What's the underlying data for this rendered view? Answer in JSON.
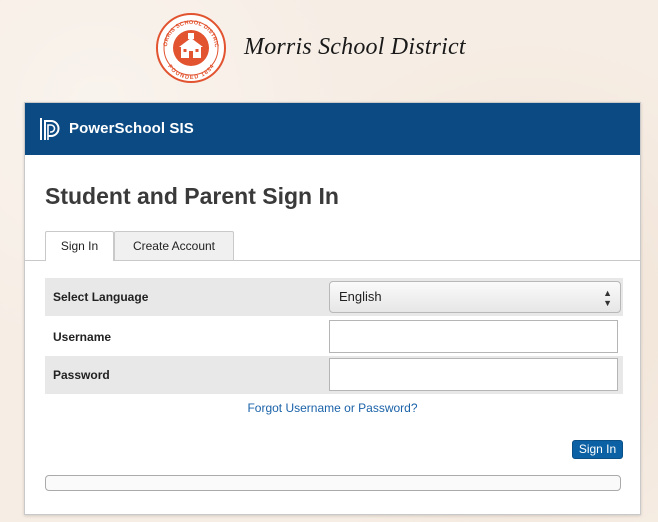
{
  "district": {
    "name": "Morris School District",
    "seal": {
      "top_text": "MORRIS SCHOOL DISTRICT",
      "bottom_text": "FOUNDED 1854",
      "color": "#e2532f"
    }
  },
  "app": {
    "title": "PowerSchool SIS",
    "header_color": "#0b4a82",
    "icon": "powerschool-logo-icon"
  },
  "page": {
    "heading": "Student and Parent Sign In"
  },
  "tabs": [
    {
      "label": "Sign In",
      "active": true
    },
    {
      "label": "Create Account",
      "active": false
    }
  ],
  "form": {
    "language": {
      "label": "Select Language",
      "value": "English",
      "icon": "select-arrows-icon"
    },
    "username": {
      "label": "Username",
      "value": "",
      "placeholder": ""
    },
    "password": {
      "label": "Password",
      "value": "",
      "placeholder": ""
    },
    "forgot_link": "Forgot Username or Password?",
    "submit_label": "Sign In",
    "progress": 0
  },
  "colors": {
    "accent": "#0b61a4",
    "link": "#1a62a8"
  }
}
